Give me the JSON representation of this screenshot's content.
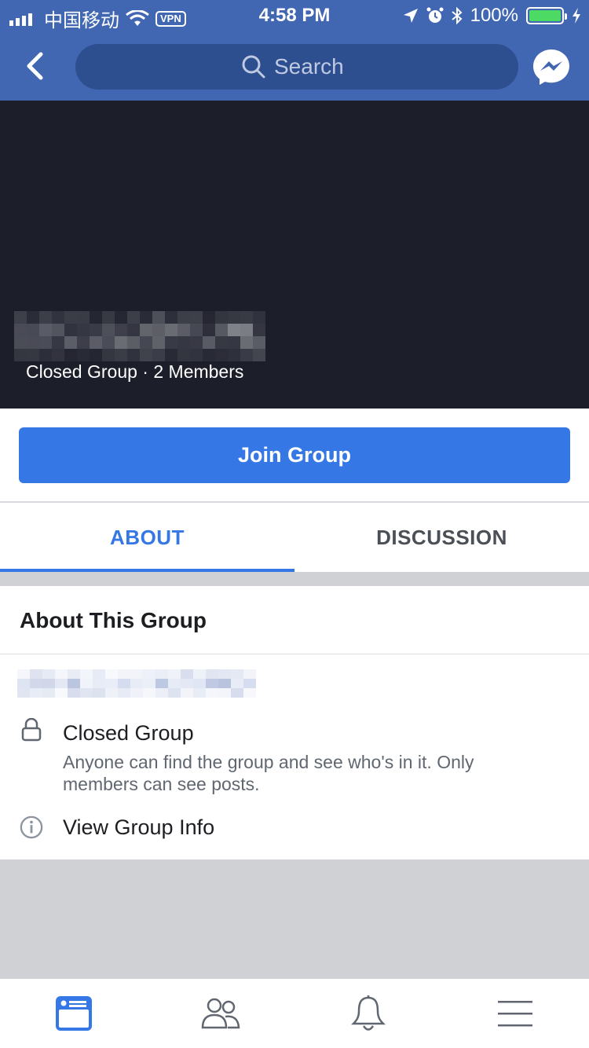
{
  "status_bar": {
    "carrier": "中国移动",
    "vpn": "VPN",
    "time": "4:58 PM",
    "battery": "100%"
  },
  "header": {
    "search_placeholder": "Search"
  },
  "cover": {
    "subtitle": "Closed Group · 2 Members"
  },
  "join": {
    "label": "Join Group"
  },
  "tabs": [
    {
      "label": "ABOUT",
      "active": true
    },
    {
      "label": "DISCUSSION",
      "active": false
    }
  ],
  "about": {
    "title": "About This Group",
    "privacy_title": "Closed Group",
    "privacy_desc": "Anyone can find the group and see who's in it. Only members can see posts.",
    "info_link": "View Group Info"
  },
  "colors": {
    "brand": "#4267b2",
    "accent": "#3578e5",
    "battery_green": "#4cd964"
  },
  "icons": [
    "signal-icon",
    "wifi-icon",
    "location-icon",
    "alarm-icon",
    "bluetooth-icon",
    "charging-icon",
    "back-chevron-icon",
    "search-icon",
    "messenger-icon",
    "lock-icon",
    "info-icon",
    "news-feed-icon",
    "friends-icon",
    "notifications-bell-icon",
    "menu-icon"
  ]
}
